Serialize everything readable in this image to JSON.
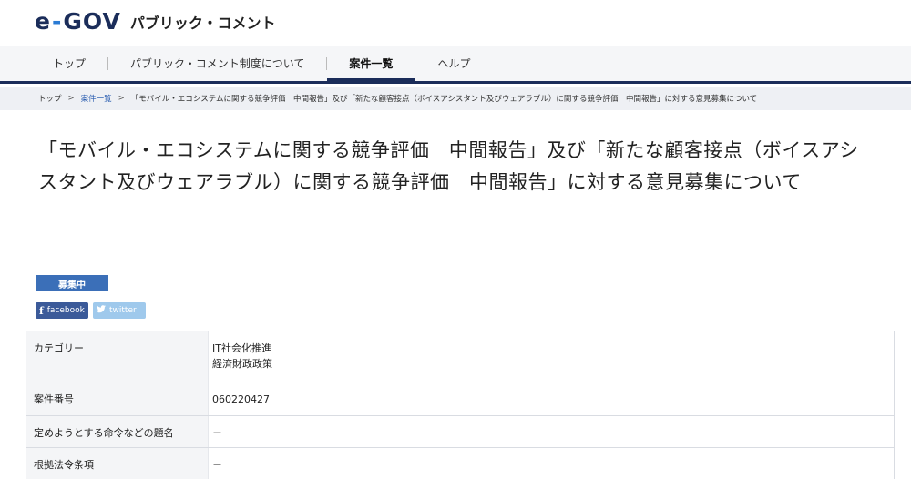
{
  "header": {
    "logo_mark_left": "e",
    "logo_mark_dash": "-",
    "logo_mark_right": "GOV",
    "logo_text": "パブリック・コメント"
  },
  "nav": {
    "items": [
      {
        "label": "トップ",
        "active": false
      },
      {
        "label": "パブリック・コメント制度について",
        "active": false
      },
      {
        "label": "案件一覧",
        "active": true
      },
      {
        "label": "ヘルプ",
        "active": false
      }
    ]
  },
  "breadcrumb": {
    "home": "トップ",
    "list": "案件一覧",
    "current": "「モバイル・エコシステムに関する競争評価　中間報告」及び「新たな顧客接点（ボイスアシスタント及びウェアラブル）に関する競争評価　中間報告」に対する意見募集について",
    "separator": ">"
  },
  "title": "「モバイル・エコシステムに関する競争評価　中間報告」及び「新たな顧客接点（ボイスアシスタント及びウェアラブル）に関する競争評価　中間報告」に対する意見募集について",
  "status_badge": "募集中",
  "social": {
    "facebook_icon": "f",
    "facebook_label": "facebook",
    "twitter_icon": "🐦",
    "twitter_label": "twitter"
  },
  "details": {
    "rows": [
      {
        "label": "カテゴリー",
        "values": [
          "IT社会化推進",
          "経済財政政策"
        ]
      },
      {
        "label": "案件番号",
        "values": [
          "060220427"
        ]
      },
      {
        "label": "定めようとする命令などの題名",
        "values": [
          "－"
        ]
      },
      {
        "label": "根拠法令条項",
        "values": [
          "－"
        ]
      }
    ]
  },
  "colors": {
    "brand_navy": "#1b2d5a",
    "accent_blue": "#3b6fb8",
    "facebook": "#3b5a99",
    "twitter": "#9fc9ec"
  }
}
